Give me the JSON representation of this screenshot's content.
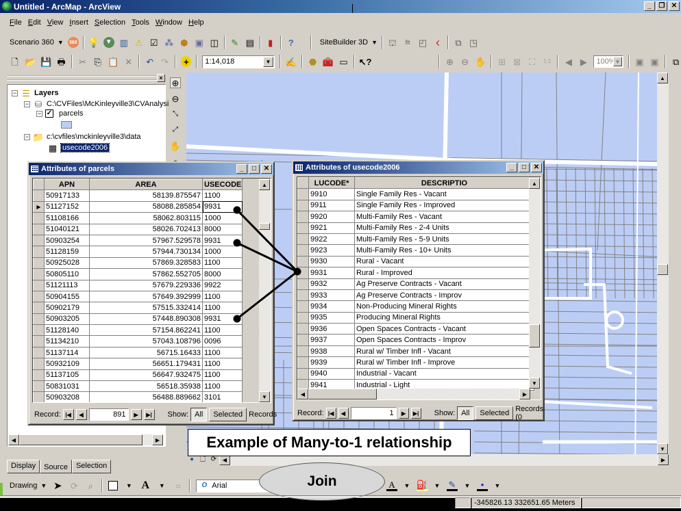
{
  "window": {
    "title": "Untitled - ArcMap - ArcView",
    "controls": [
      "_",
      "▫",
      "×"
    ]
  },
  "menu": [
    {
      "label": "File",
      "key": "F"
    },
    {
      "label": "Edit",
      "key": "E"
    },
    {
      "label": "View",
      "key": "V"
    },
    {
      "label": "Insert",
      "key": "I"
    },
    {
      "label": "Selection",
      "key": "S"
    },
    {
      "label": "Tools",
      "key": "T"
    },
    {
      "label": "Window",
      "key": "W"
    },
    {
      "label": "Help",
      "key": "H"
    }
  ],
  "toolbar1": {
    "scenario_label": "Scenario 360",
    "sitebuilder_label": "SiteBuilder 3D",
    "icons": [
      "scenario-360-icon",
      "lightbulb-icon",
      "download-icon",
      "chart-icon",
      "warning-icon",
      "checklist-icon",
      "hierarchy-icon",
      "box-icon",
      "image-icon",
      "layout-icon",
      "pencil-icon",
      "table-icon",
      "bar-chart-icon",
      "help-icon"
    ],
    "sitebuilder_icons": [
      "sb-model-icon",
      "sb-flt-icon",
      "sb-frame-icon",
      "sb-red-chevron-icon",
      "sb-export-icon",
      "sb-window-icon"
    ]
  },
  "toolbar2": {
    "scale_value": "1:14,018",
    "zoom_value": "100%",
    "icons": [
      "new-icon",
      "open-icon",
      "save-icon",
      "print-icon",
      "cut-icon",
      "copy-icon",
      "paste-icon",
      "delete-icon",
      "undo-icon",
      "redo-icon",
      "add-data-icon"
    ],
    "right_icons": [
      "editor-icon",
      "arctoolbox-icon",
      "toolbox-icon",
      "command-line-icon",
      "whats-this-icon"
    ]
  },
  "toc": {
    "root_label": "Layers",
    "items": [
      {
        "label": "C:\\CVFiles\\McKinleyville3\\CVAnalysi",
        "type": "database"
      },
      {
        "label": "parcels",
        "type": "layer",
        "checked": true
      },
      {
        "label": "c:\\cvfiles\\mckinleyville3\\data",
        "type": "folder"
      },
      {
        "label": "usecode2006",
        "type": "table",
        "selected": true
      }
    ],
    "tabs": [
      "Display",
      "Source",
      "Selection"
    ],
    "active_tab": "Source"
  },
  "parcels_table": {
    "title": "Attributes of parcels",
    "columns": [
      "APN",
      "AREA",
      "USECODE"
    ],
    "rows": [
      [
        "50917133",
        "58139.875547",
        "1100"
      ],
      [
        "51127152",
        "58088.285854",
        "9931"
      ],
      [
        "51108166",
        "58062.803115",
        "1000"
      ],
      [
        "51040121",
        "58026.702413",
        "8000"
      ],
      [
        "50903254",
        "57967.529578",
        "9931"
      ],
      [
        "51128159",
        "57944.730134",
        "1000"
      ],
      [
        "50925028",
        "57869.328583",
        "1100"
      ],
      [
        "50805110",
        "57862.552705",
        "8000"
      ],
      [
        "51121113",
        "57679.229336",
        "9922"
      ],
      [
        "50904155",
        "57649.392999",
        "1100"
      ],
      [
        "50902179",
        "57515.332414",
        "1100"
      ],
      [
        "50903205",
        "57448.890308",
        "9931"
      ],
      [
        "51128140",
        "57154.862241",
        "1100"
      ],
      [
        "51134210",
        "57043.108796",
        "0096"
      ],
      [
        "51137114",
        "56715.16433",
        "1100"
      ],
      [
        "50932109",
        "56651.179431",
        "1100"
      ],
      [
        "51137105",
        "56647.932475",
        "1100"
      ],
      [
        "50831031",
        "56518.35938",
        "1100"
      ],
      [
        "50903208",
        "56488.889662",
        "3101"
      ]
    ],
    "current_row": 1,
    "record_label": "Record:",
    "record_value": "891",
    "show_label": "Show:",
    "all_label": "All",
    "selected_label": "Selected",
    "records_label": "Records"
  },
  "usecode_table": {
    "title": "Attributes of usecode2006",
    "columns": [
      "LUCODE*",
      "DESCRIPTIO"
    ],
    "rows": [
      [
        "9910",
        "Single Family Res - Vacant"
      ],
      [
        "9911",
        "Single Family Res - Improved"
      ],
      [
        "9920",
        "Multi-Family Res - Vacant"
      ],
      [
        "9921",
        "Multi-Family Res - 2-4 Units"
      ],
      [
        "9922",
        "Multi-Family Res - 5-9 Units"
      ],
      [
        "9923",
        "Multi-Family Res - 10+ Units"
      ],
      [
        "9930",
        "Rural - Vacant"
      ],
      [
        "9931",
        "Rural - Improved"
      ],
      [
        "9932",
        "Ag Preserve Contracts - Vacant"
      ],
      [
        "9933",
        "Ag Preserve Contracts - Improv"
      ],
      [
        "9934",
        "Non-Producing Mineral Rights"
      ],
      [
        "9935",
        "Producing Mineral Rights"
      ],
      [
        "9936",
        "Open Spaces Contracts - Vacant"
      ],
      [
        "9937",
        "Open Spaces Contracts - Improv"
      ],
      [
        "9938",
        "Rural w/ Timber Infl - Vacant"
      ],
      [
        "9939",
        "Rural w/ Timber Infl - Improve"
      ],
      [
        "9940",
        "Industrial - Vacant"
      ],
      [
        "9941",
        "Industrial - Light"
      ]
    ],
    "record_label": "Record:",
    "record_value": "1",
    "show_label": "Show:",
    "all_label": "All",
    "selected_label": "Selected",
    "records_label": "Records (0"
  },
  "annotations": {
    "callout": "Example of Many-to-1 relationship",
    "join_label": "Join"
  },
  "drawing_toolbar": {
    "drawing_label": "Drawing",
    "font_value": "Arial"
  },
  "status": {
    "coordinates": "-345826.13  332651.65 Meters"
  },
  "colors": {
    "map_fill": "#bccdf5",
    "parcel_line": "#808080",
    "title_gradient_start": "#0a246a",
    "title_gradient_end": "#a6caf0",
    "chrome": "#d4d0c8"
  }
}
